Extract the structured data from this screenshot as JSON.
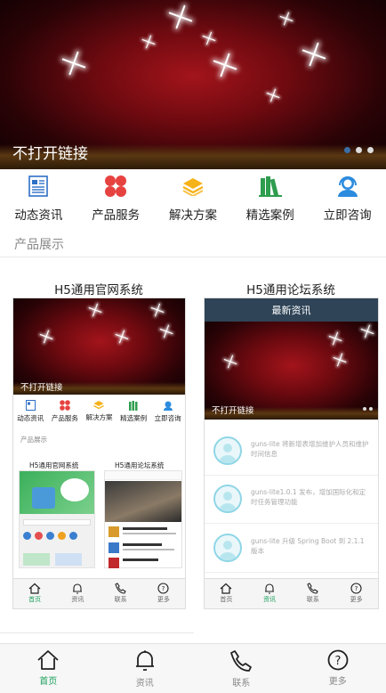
{
  "banner": {
    "caption": "不打开链接",
    "slides": 3,
    "active_slide": 0
  },
  "nav": [
    {
      "label": "动态资讯",
      "icon": "news-icon"
    },
    {
      "label": "产品服务",
      "icon": "product-service-icon"
    },
    {
      "label": "解决方案",
      "icon": "solution-stack-icon"
    },
    {
      "label": "精选案例",
      "icon": "books-icon"
    },
    {
      "label": "立即咨询",
      "icon": "support-agent-icon"
    }
  ],
  "section": {
    "title": "产品展示"
  },
  "products": [
    {
      "title": "H5通用官网系统",
      "preview": {
        "banner_caption": "不打开链接",
        "nav": [
          "动态资讯",
          "产品服务",
          "解决方案",
          "精选案例",
          "立即咨询"
        ],
        "section_title": "产品展示",
        "sub_titles": [
          "H5通用官网系统",
          "H5通用论坛系统"
        ],
        "tabs": [
          "首页",
          "资讯",
          "联系",
          "更多"
        ],
        "active_tab": 0
      }
    },
    {
      "title": "H5通用论坛系统",
      "preview": {
        "header": "最新资讯",
        "banner_caption": "不打开链接",
        "news": [
          "guns-lite 将新增表增加维护人员和维护时间信息",
          "guns-lite1.0.1 发布，增加国际化和定时任务管理功能",
          "guns-lite 升级 Spring Boot 到 2.1.1 版本"
        ],
        "tabs": [
          "首页",
          "资讯",
          "联系",
          "更多"
        ],
        "active_tab": 1
      }
    }
  ],
  "tabbar": {
    "items": [
      {
        "label": "首页",
        "icon": "home-icon"
      },
      {
        "label": "资讯",
        "icon": "bell-icon"
      },
      {
        "label": "联系",
        "icon": "phone-icon"
      },
      {
        "label": "更多",
        "icon": "help-icon"
      }
    ],
    "active": 0
  },
  "colors": {
    "accent": "#1aa05a",
    "news_header": "#2f4457",
    "banner": "#8b0f16"
  }
}
